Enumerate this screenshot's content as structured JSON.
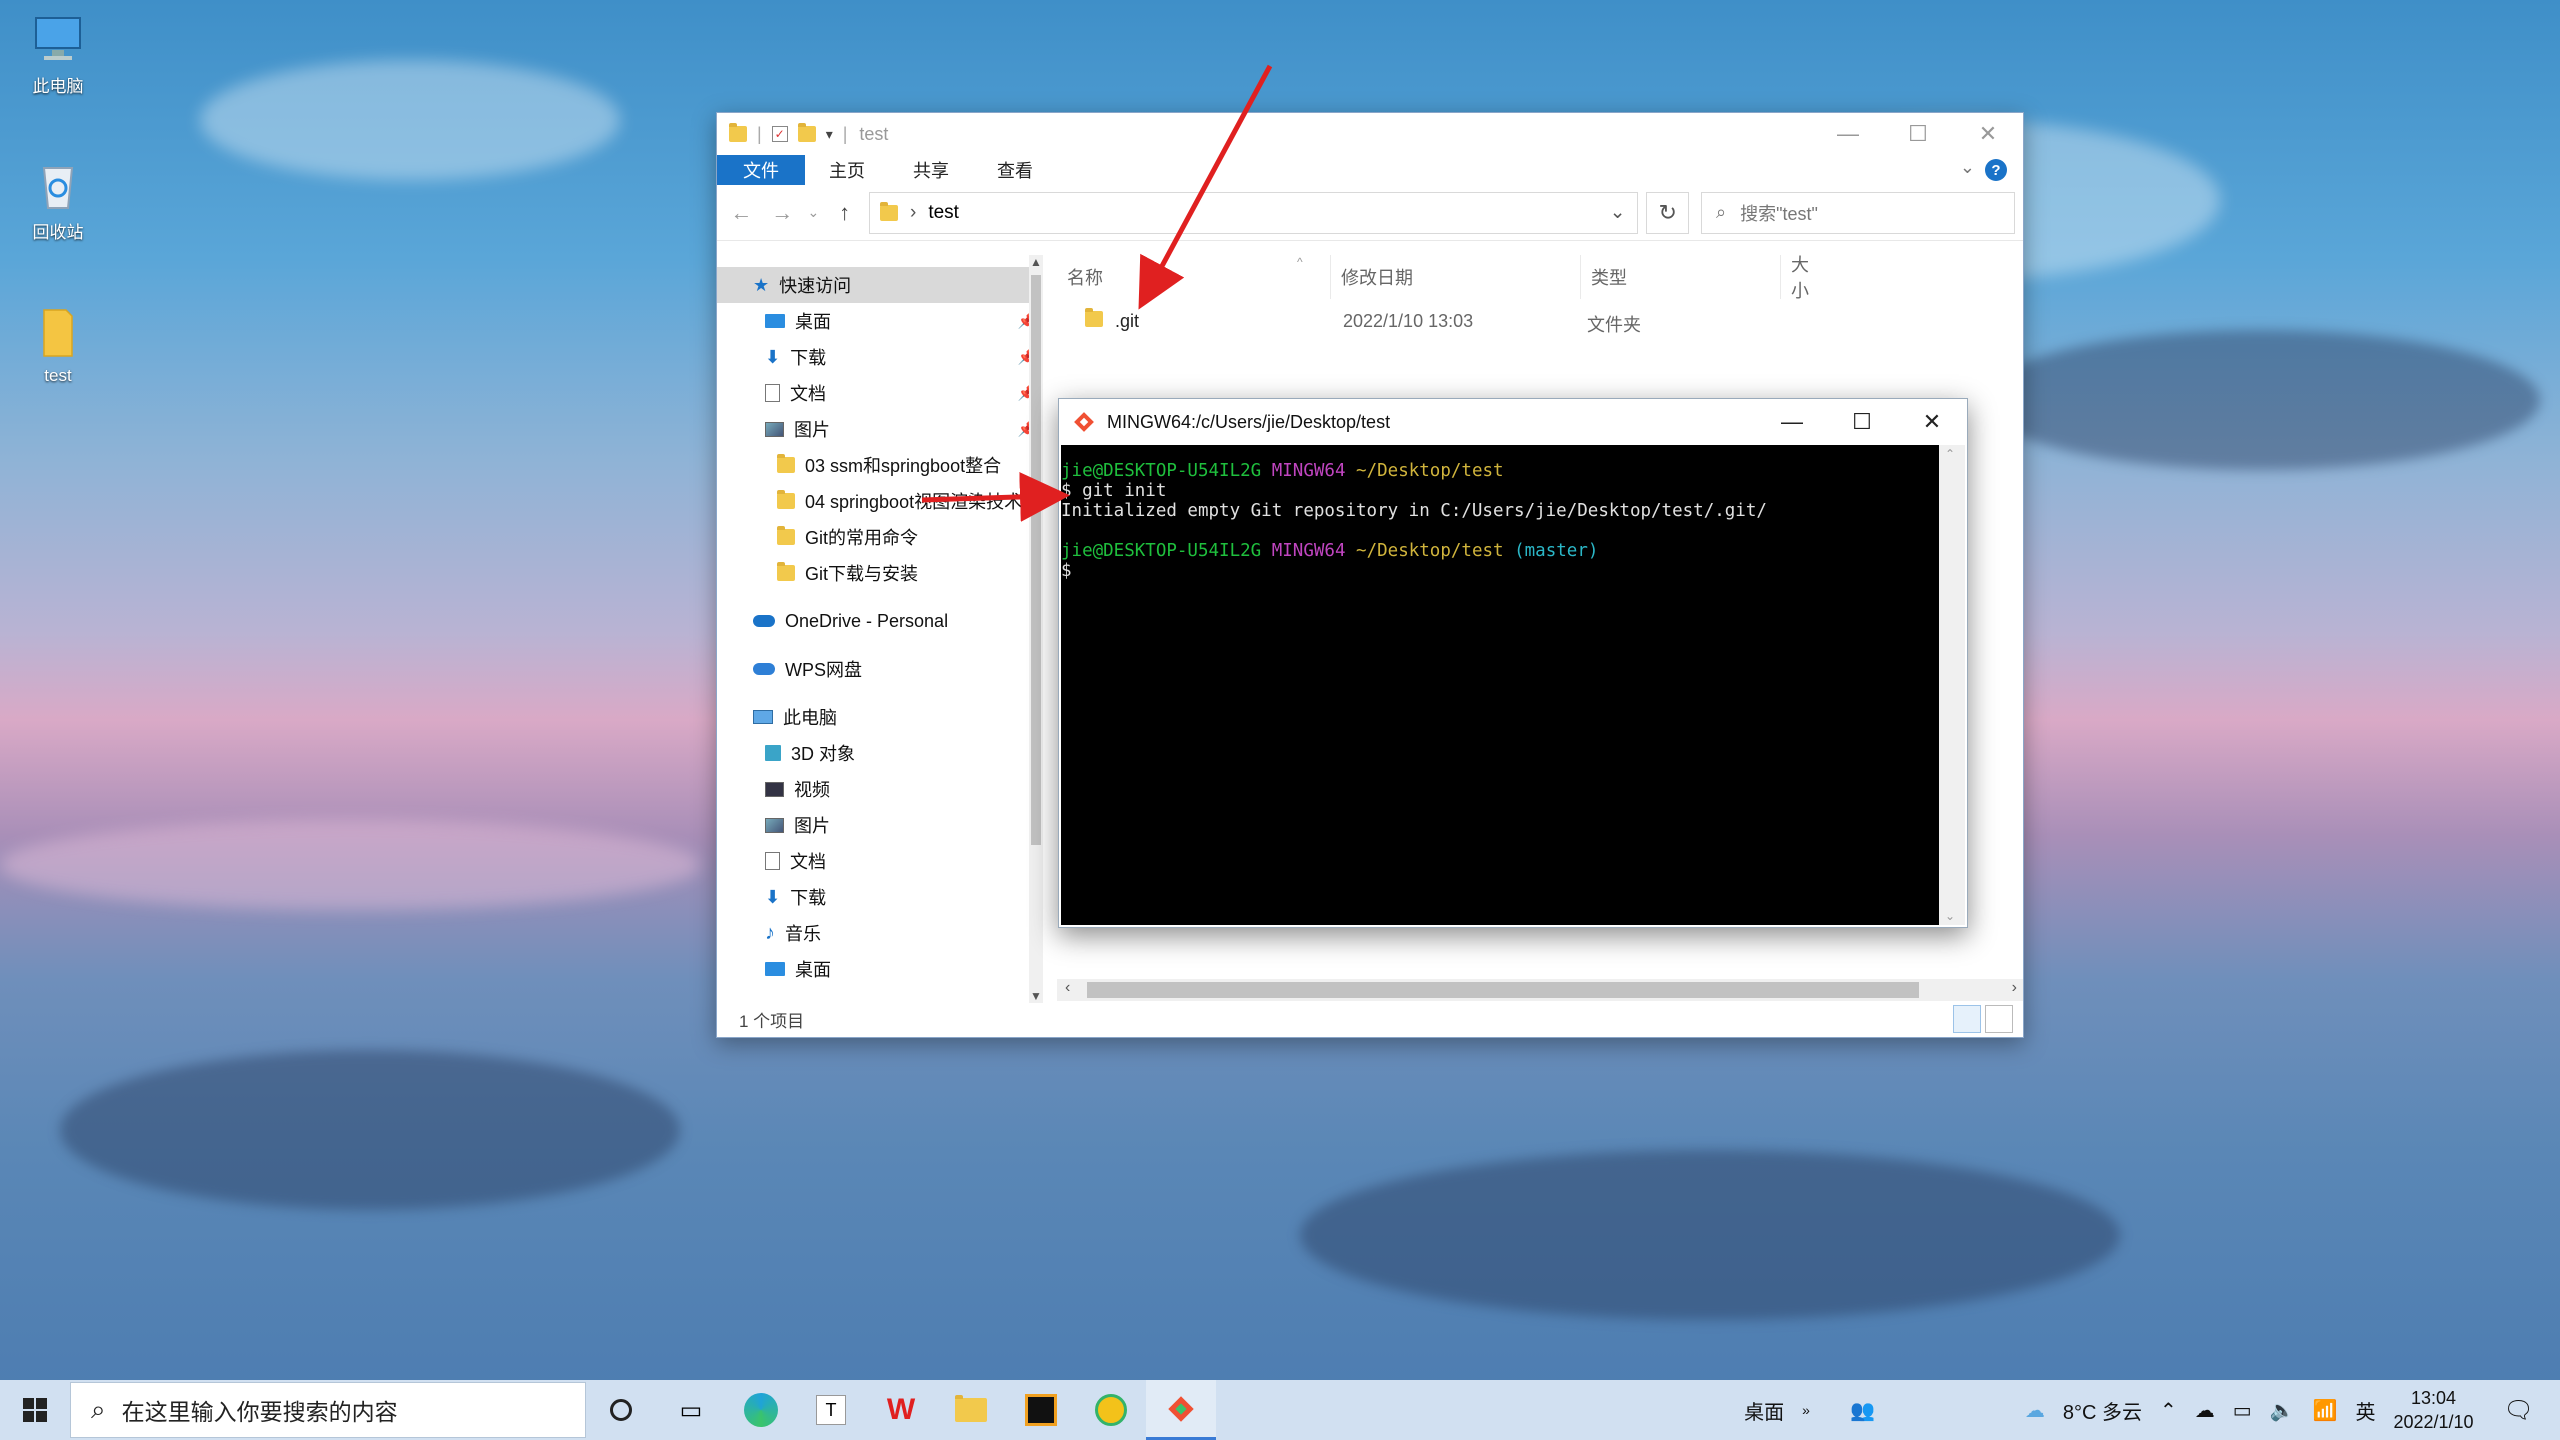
{
  "desktop": {
    "icons": [
      {
        "label": "此电脑"
      },
      {
        "label": "回收站"
      },
      {
        "label": "test"
      }
    ]
  },
  "explorer": {
    "title": "test",
    "ribbon_tabs": [
      "文件",
      "主页",
      "共享",
      "查看"
    ],
    "address": "test",
    "search_placeholder": "搜索\"test\"",
    "nav": {
      "quick_access": "快速访问",
      "pinned": [
        {
          "label": "桌面",
          "icon": "desktop-icon"
        },
        {
          "label": "下载",
          "icon": "download-icon"
        },
        {
          "label": "文档",
          "icon": "document-icon"
        },
        {
          "label": "图片",
          "icon": "pictures-icon"
        }
      ],
      "folders": [
        "03 ssm和springboot整合",
        "04 springboot视图渲染技术",
        "Git的常用命令",
        "Git下载与安装"
      ],
      "onedrive": "OneDrive - Personal",
      "wps": "WPS网盘",
      "this_pc": "此电脑",
      "pc_items": [
        {
          "label": "3D 对象",
          "icon": "3d-objects-icon"
        },
        {
          "label": "视频",
          "icon": "video-icon"
        },
        {
          "label": "图片",
          "icon": "pictures-icon"
        },
        {
          "label": "文档",
          "icon": "document-icon"
        },
        {
          "label": "下载",
          "icon": "download-icon"
        },
        {
          "label": "音乐",
          "icon": "music-icon"
        },
        {
          "label": "桌面",
          "icon": "desktop-icon"
        }
      ]
    },
    "columns": {
      "name": "名称",
      "modified": "修改日期",
      "type": "类型",
      "size": "大小"
    },
    "files": [
      {
        "name": ".git",
        "modified": "2022/1/10 13:03",
        "type": "文件夹"
      }
    ],
    "status": "1 个项目"
  },
  "terminal": {
    "title": "MINGW64:/c/Users/jie/Desktop/test",
    "prompt1": {
      "user": "jie@DESKTOP-U54IL2G",
      "env": "MINGW64",
      "path": "~/Desktop/test"
    },
    "command": "$ git init",
    "output": "Initialized empty Git repository in C:/Users/jie/Desktop/test/.git/",
    "prompt2": {
      "user": "jie@DESKTOP-U54IL2G",
      "env": "MINGW64",
      "path": "~/Desktop/test",
      "branch": "(master)"
    },
    "cursor": "$"
  },
  "taskbar": {
    "search_placeholder": "在这里输入你要搜索的内容",
    "desktop_label": "桌面",
    "weather": "8°C 多云",
    "ime": "英",
    "time": "13:04",
    "date": "2022/1/10"
  },
  "colors": {
    "accent": "#1a73c8",
    "arrow": "#e02020",
    "term_green": "#1fbf3d",
    "term_magenta": "#c045c0",
    "term_yellow": "#d0b43c",
    "term_cyan": "#2bb7c7"
  }
}
